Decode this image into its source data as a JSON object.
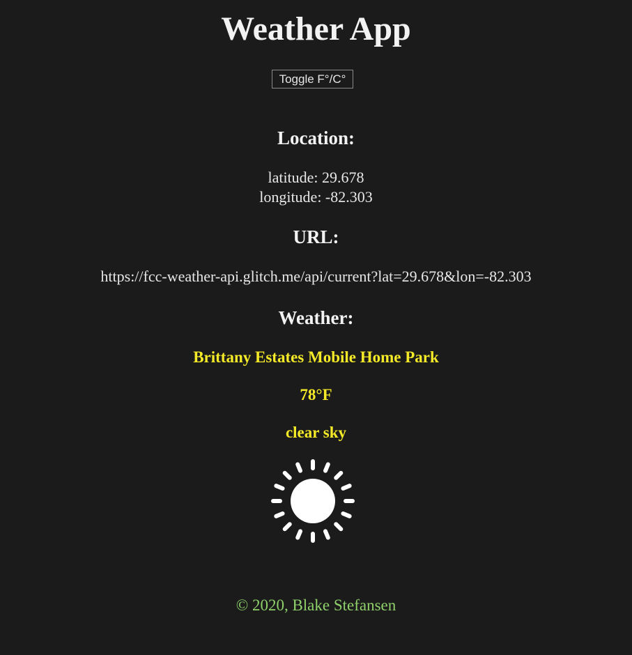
{
  "app": {
    "title": "Weather App",
    "toggle_label": "Toggle F°/C°"
  },
  "location": {
    "heading": "Location:",
    "latitude_text": "latitude: 29.678",
    "longitude_text": "longitude: -82.303"
  },
  "url": {
    "heading": "URL:",
    "value": "https://fcc-weather-api.glitch.me/api/current?lat=29.678&lon=-82.303"
  },
  "weather": {
    "heading": "Weather:",
    "place": "Brittany Estates Mobile Home Park",
    "temperature": "78°F",
    "condition": "clear sky",
    "icon": "sun-icon"
  },
  "footer": {
    "text": "© 2020, Blake Stefansen"
  },
  "colors": {
    "background": "#1b1b1b",
    "accent_yellow": "#f4ea27",
    "footer_green": "#8fd16a",
    "text": "#e8e8e8"
  }
}
